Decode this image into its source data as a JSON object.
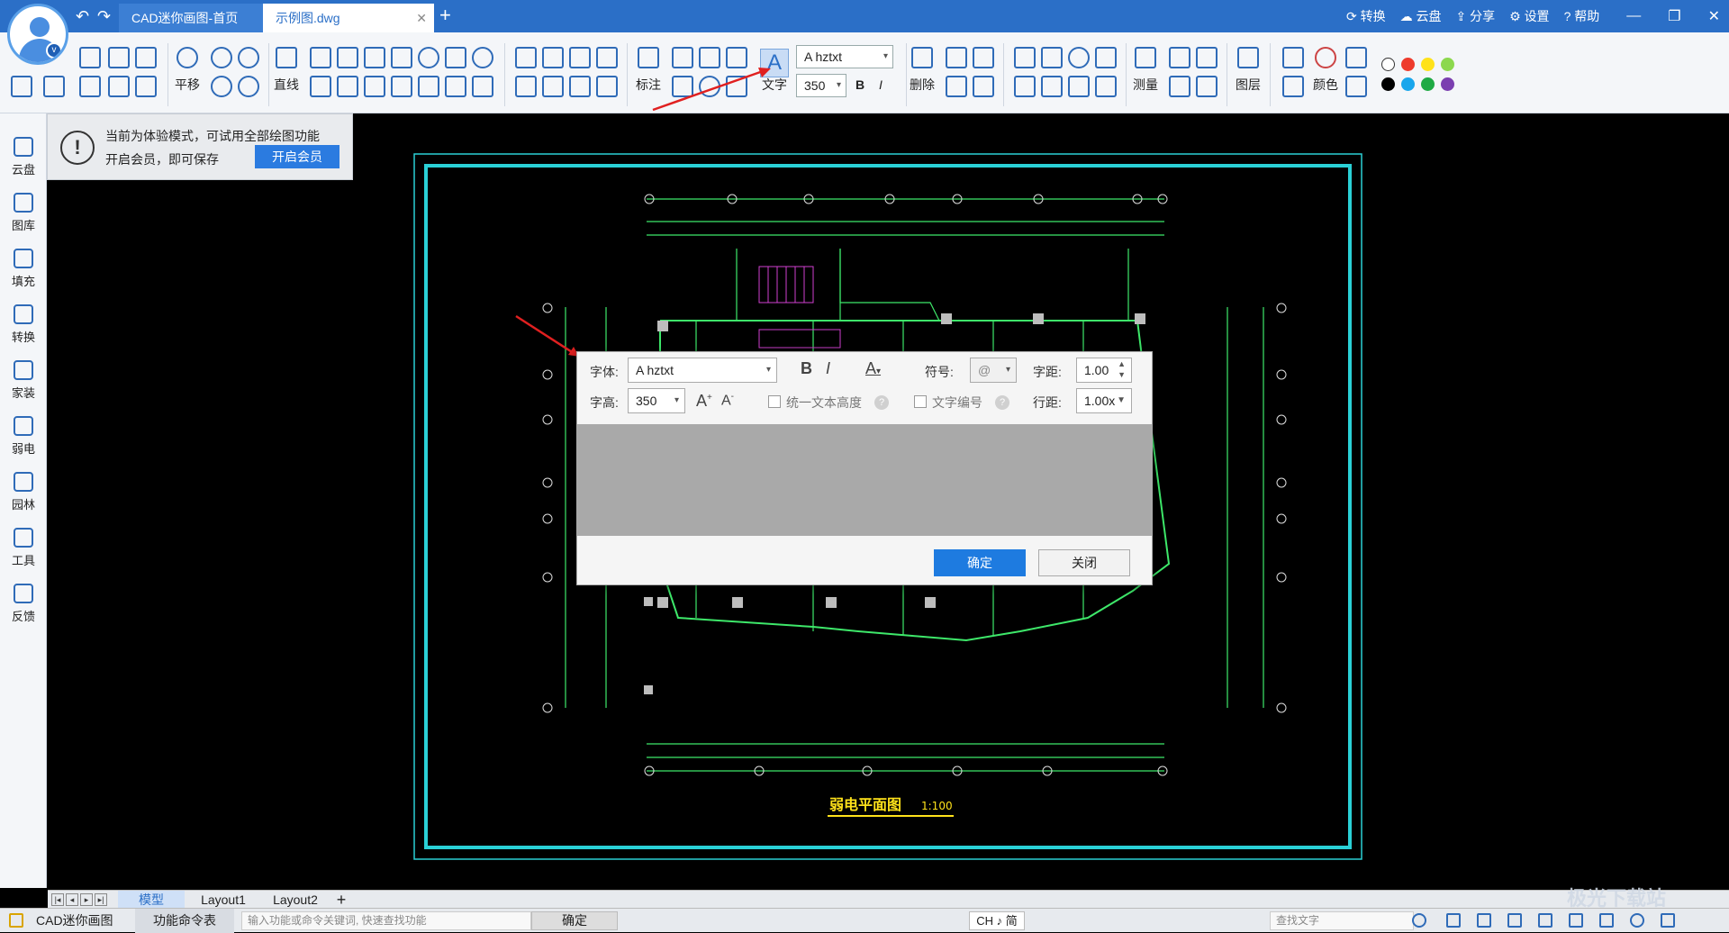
{
  "window": {
    "tabs": [
      {
        "label": "CAD迷你画图-首页"
      },
      {
        "label": "示例图.dwg"
      }
    ],
    "top_actions": [
      "转换",
      "云盘",
      "分享",
      "设置",
      "帮助"
    ]
  },
  "ribbon": {
    "pan_label": "平移",
    "line_label": "直线",
    "dim_label": "标注",
    "text_label": "文字",
    "font_value": "hztxt",
    "height_value": "350",
    "bold": "B",
    "italic": "I",
    "delete_label": "删除",
    "measure_label": "测量",
    "layer_label": "图层",
    "color_label": "颜色",
    "palette": [
      "#ffffff",
      "#ee3b2c",
      "#ffe21a",
      "#8cd84e",
      "#000000",
      "#19a6ec",
      "#1faa44",
      "#7b3fb0"
    ]
  },
  "notice": {
    "line1": "当前为体验模式，可试用全部绘图功能",
    "line2": "开启会员，即可保存",
    "button": "开启会员"
  },
  "sidebar": {
    "items": [
      {
        "label": "云盘",
        "icon": "cloud-icon"
      },
      {
        "label": "图库",
        "icon": "image-library-icon"
      },
      {
        "label": "填充",
        "icon": "fill-icon"
      },
      {
        "label": "转换",
        "icon": "convert-icon"
      },
      {
        "label": "家装",
        "icon": "home-icon"
      },
      {
        "label": "弱电",
        "icon": "electric-icon"
      },
      {
        "label": "园林",
        "icon": "tree-icon"
      },
      {
        "label": "工具",
        "icon": "tool-icon"
      },
      {
        "label": "反馈",
        "icon": "mail-icon"
      }
    ]
  },
  "drawing": {
    "title": "弱电平面图",
    "scale": "1:100"
  },
  "dialog": {
    "font_label": "字体:",
    "font_value": "hztxt",
    "bold": "B",
    "italic": "I",
    "color_btn": "A",
    "symbol_label": "符号:",
    "symbol_value": "@",
    "spacing_label": "字距:",
    "spacing_value": "1.00",
    "height_label": "字高:",
    "height_value": "350",
    "grow": "A",
    "shrink": "A",
    "uniform_label": "统一文本高度",
    "numbering_label": "文字编号",
    "line_spacing_label": "行距:",
    "line_spacing_value": "1.00x",
    "ok": "确定",
    "close": "关闭"
  },
  "layout_tabs": [
    "模型",
    "Layout1",
    "Layout2"
  ],
  "statusbar": {
    "app": "CAD迷你画图",
    "cmd_table": "功能命令表",
    "cmd_placeholder": "输入功能或命令关键词, 快速查找功能",
    "confirm": "确定",
    "ime": "CH ♪ 简",
    "search_placeholder": "查找文字"
  },
  "watermark": "极光下载站"
}
